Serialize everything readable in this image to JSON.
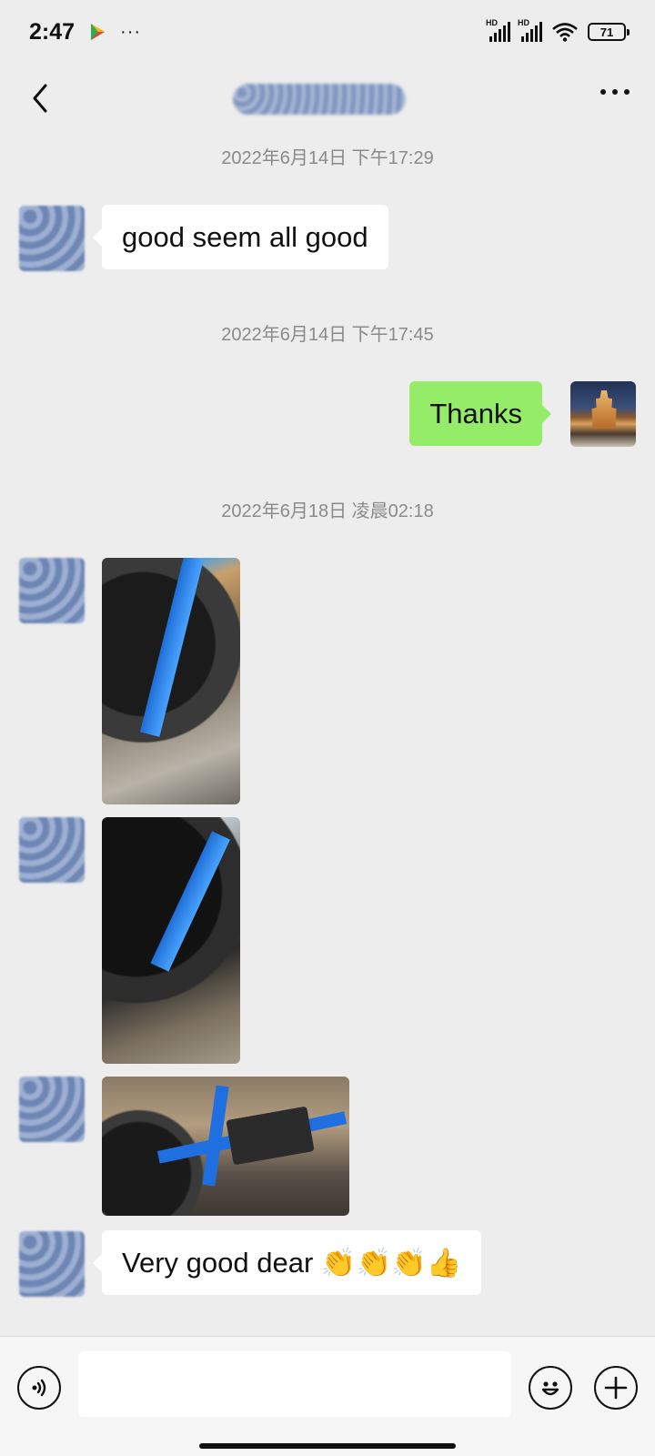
{
  "status_bar": {
    "time": "2:47",
    "dots": "···",
    "signal1_label": "HD",
    "signal2_label": "HD",
    "battery": "71",
    "icons": [
      "play-store-icon",
      "signal-icon",
      "signal-icon",
      "wifi-icon",
      "battery-icon"
    ]
  },
  "header": {
    "title": "",
    "back_icon": "chevron-left-icon",
    "more_icon": "more-dots-icon"
  },
  "chat": {
    "messages": [
      {
        "timestamp": "2022年6月14日 下午17:29"
      },
      {
        "direction": "in",
        "type": "text",
        "text": "good seem all good"
      },
      {
        "timestamp": "2022年6月14日 下午17:45"
      },
      {
        "direction": "out",
        "type": "text",
        "text": "Thanks"
      },
      {
        "timestamp": "2022年6月18日 凌晨02:18"
      },
      {
        "direction": "in",
        "type": "image"
      },
      {
        "direction": "in",
        "type": "image"
      },
      {
        "direction": "in",
        "type": "image"
      },
      {
        "direction": "in",
        "type": "text",
        "text": "Very good dear 👏👏👏👍"
      }
    ]
  },
  "input_bar": {
    "placeholder": "",
    "voice_icon": "voice-icon",
    "emoji_icon": "emoji-icon",
    "plus_icon": "plus-icon"
  },
  "colors": {
    "background": "#ededed",
    "incoming_bubble": "#ffffff",
    "outgoing_bubble": "#95ec69",
    "timestamp_text": "#8a8a8a"
  }
}
